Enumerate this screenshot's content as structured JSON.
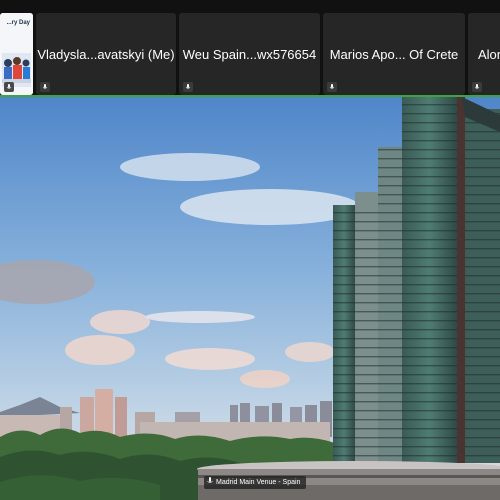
{
  "participants": [
    {
      "name": "",
      "banner": "...ry Day",
      "muted": true
    },
    {
      "name": "Vladysla...avatskyi (Me)",
      "muted": true
    },
    {
      "name": "Weu Spain...wx576654",
      "muted": true
    },
    {
      "name": "Marios Apo... Of Crete",
      "muted": true
    },
    {
      "name": "Alon",
      "muted": true
    }
  ],
  "main_video": {
    "label": "Madrid Main Venue - Spain",
    "scene": "city skyline with glass skyscraper under blue sky"
  },
  "colors": {
    "active_speaker": "#3fa33f",
    "strip_bg": "#111111",
    "tile_bg": "#262626"
  }
}
